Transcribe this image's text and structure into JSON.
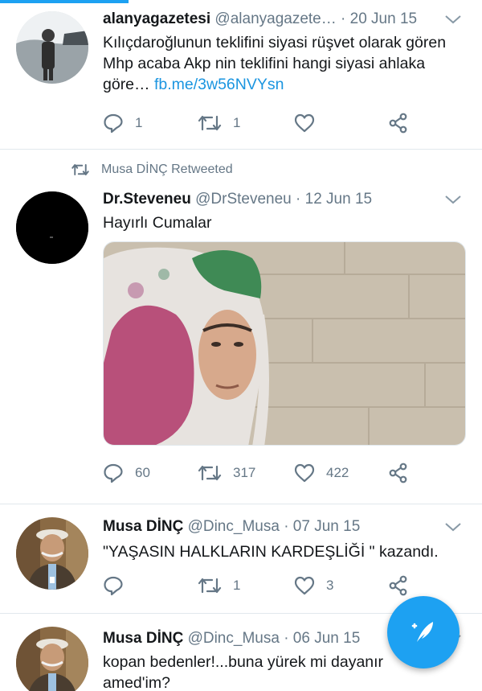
{
  "tweets": [
    {
      "name": "alanyagazetesi",
      "handle": "@alanyagazete…",
      "separator": "·",
      "date": "20 Jun 15",
      "text": "Kılıçdaroğlunun teklifini siyasi rüşvet olarak gören Mhp acaba Akp nin teklifini hangi siyasi ahlaka göre…",
      "link": "fb.me/3w56NVYsn",
      "replies": "1",
      "retweets": "1",
      "likes": ""
    },
    {
      "retweeted_by": "Musa DİNÇ Retweeted",
      "name": "Dr.Steveneu",
      "handle": "@DrSteveneu",
      "separator": "·",
      "date": "12 Jun 15",
      "text": "Hayırlı Cumalar",
      "replies": "60",
      "retweets": "317",
      "likes": "422"
    },
    {
      "name": "Musa DİNÇ",
      "handle": "@Dinc_Musa",
      "separator": "·",
      "date": "07 Jun 15",
      "text": "\"YAŞASIN HALKLARIN KARDEŞLİĞİ \" kazandı.",
      "replies": "",
      "retweets": "1",
      "likes": "3"
    },
    {
      "name": "Musa DİNÇ",
      "handle": "@Dinc_Musa",
      "separator": "·",
      "date": "06 Jun 15",
      "text_line1": "kopan bedenler!...buna yürek mi dayanır",
      "text_line2": "amed'im?"
    }
  ],
  "colors": {
    "accent": "#1da1f2",
    "link": "#1b95e0",
    "muted": "#657786",
    "text": "#14171a",
    "divider": "#e1e8ed"
  },
  "icons": [
    "reply-icon",
    "retweet-icon",
    "like-icon",
    "share-icon",
    "chevron-down-icon",
    "compose-icon"
  ]
}
